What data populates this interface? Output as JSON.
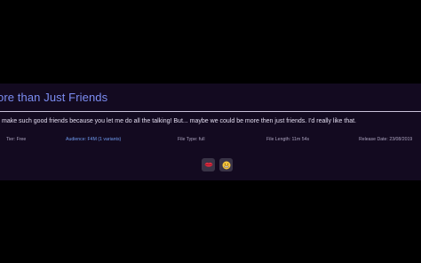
{
  "post": {
    "title": "ore than Just Friends",
    "description": "make such good friends because you let me do all the talking! But... maybe we could be more then just friends. I'd really like that.",
    "meta": {
      "tier": "Tier: Free",
      "audience": "Audience: F4M (1 variants)",
      "file_type": "File Type: full",
      "file_length": "File Length: 11m 54s",
      "release_date": "Release Date: 23/08/2019"
    },
    "reactions": [
      {
        "icon": "lips-icon"
      },
      {
        "icon": "grimace-face-icon"
      }
    ]
  },
  "colors": {
    "background": "#000000",
    "card": "#130a20",
    "title": "#7c8df2",
    "link": "#6f9bf0",
    "text": "#e2dcef",
    "meta": "#aaa2bd"
  }
}
